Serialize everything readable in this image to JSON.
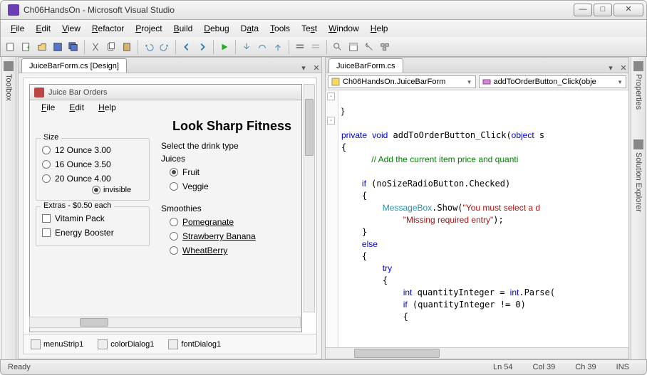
{
  "window": {
    "title": "Ch06HandsOn - Microsoft Visual Studio"
  },
  "menu": {
    "items": [
      "File",
      "Edit",
      "View",
      "Refactor",
      "Project",
      "Build",
      "Debug",
      "Data",
      "Tools",
      "Test",
      "Window",
      "Help"
    ]
  },
  "side_tabs": {
    "left": "Toolbox",
    "right_top": "Properties",
    "right_bottom": "Solution Explorer"
  },
  "left_pane": {
    "tab_title": "JuiceBarForm.cs [Design]",
    "form": {
      "title": "Juice Bar Orders",
      "menu": [
        "File",
        "Edit",
        "Help"
      ],
      "headline": "Look Sharp Fitness",
      "size_group": {
        "title": "Size",
        "options": [
          "12 Ounce 3.00",
          "16 Ounce 3.50",
          "20 Ounce 4.00"
        ],
        "invisible_label": "invisible"
      },
      "extras_group": {
        "title": "Extras - $0.50 each",
        "options": [
          "Vitamin Pack",
          "Energy Booster"
        ]
      },
      "drink_label": "Select the drink type",
      "juices": {
        "title": "Juices",
        "options": [
          "Fruit",
          "Veggie"
        ],
        "selected": 0
      },
      "smoothies": {
        "title": "Smoothies",
        "options": [
          "Pomegranate",
          "Strawberry Banana",
          "WheatBerry"
        ]
      }
    },
    "tray": [
      "menuStrip1",
      "colorDialog1",
      "fontDialog1"
    ]
  },
  "right_pane": {
    "tab_title": "JuiceBarForm.cs",
    "dropdown_left": "Ch06HandsOn.JuiceBarForm",
    "dropdown_right": "addToOrderButton_Click(obje",
    "code": {
      "l1": "}",
      "l2": "private void addToOrderButton_Click(object s",
      "l3": "{",
      "l4": "    // Add the current item price and quanti",
      "l5": "    if (noSizeRadioButton.Checked)",
      "l6": "    {",
      "l7": "        MessageBox.Show(\"You must select a d",
      "l8": "            \"Missing required entry\");",
      "l9": "    }",
      "l10": "    else",
      "l11": "    {",
      "l12": "        try",
      "l13": "        {",
      "l14": "            int quantityInteger = int.Parse(",
      "l15": "            if (quantityInteger != 0)",
      "l16": "            {"
    }
  },
  "status": {
    "ready": "Ready",
    "ln": "Ln 54",
    "col": "Col 39",
    "ch": "Ch 39",
    "ins": "INS"
  }
}
